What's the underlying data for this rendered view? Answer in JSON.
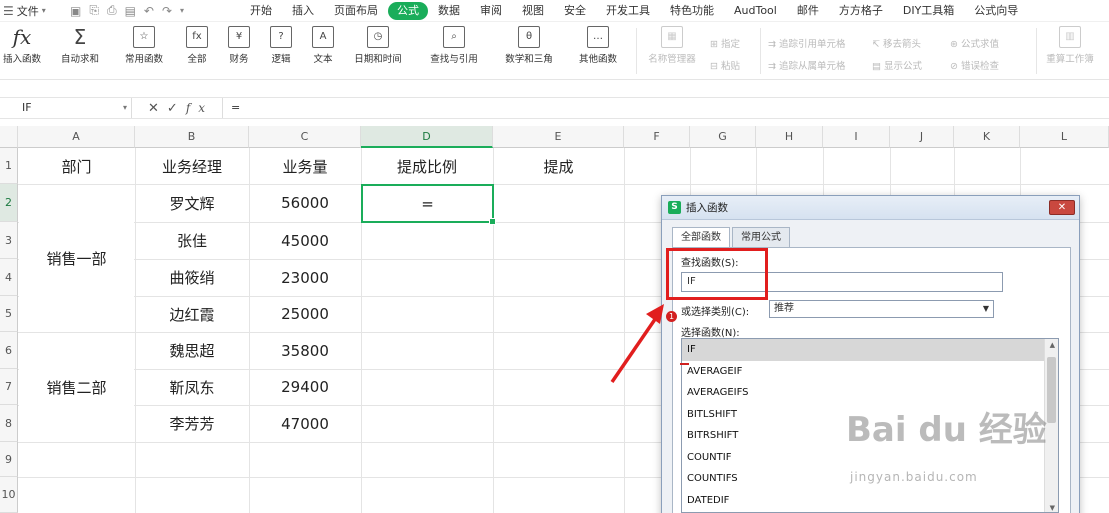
{
  "menubar": {
    "file_label": "文件",
    "tabs": [
      "开始",
      "插入",
      "页面布局",
      "公式",
      "数据",
      "审阅",
      "视图",
      "安全",
      "开发工具",
      "特色功能",
      "AudTool",
      "邮件",
      "方方格子",
      "DIY工具箱",
      "公式向导"
    ],
    "active_tab_index": 3
  },
  "ribbon": {
    "buttons": [
      "插入函数",
      "自动求和",
      "常用函数",
      "全部",
      "财务",
      "逻辑",
      "文本",
      "日期和时间",
      "查找与引用",
      "数学和三角",
      "其他函数"
    ],
    "grayed_big": [
      "名称管理器",
      "重算工作簿"
    ],
    "grayed_small": [
      "指定",
      "粘贴",
      "追踪引用单元格",
      "移去箭头",
      "公式求值",
      "追踪从属单元格",
      "显示公式",
      "错误检查"
    ]
  },
  "formula_bar": {
    "name_box": "IF",
    "content": "="
  },
  "columns": [
    "A",
    "B",
    "C",
    "D",
    "E",
    "F",
    "G",
    "H",
    "I",
    "J",
    "K",
    "L"
  ],
  "rows": [
    "1",
    "2",
    "3",
    "4",
    "5",
    "6",
    "7",
    "8",
    "9",
    "10"
  ],
  "sheet": {
    "headers": [
      "部门",
      "业务经理",
      "业务量",
      "提成比例",
      "提成"
    ],
    "departments": [
      "销售一部",
      "销售二部"
    ],
    "managers": [
      "罗文辉",
      "张佳",
      "曲筱绡",
      "边红霞",
      "魏思超",
      "靳凤东",
      "李芳芳"
    ],
    "volumes": [
      "56000",
      "45000",
      "23000",
      "25000",
      "35800",
      "29400",
      "47000"
    ],
    "active_cell_value": "="
  },
  "dialog": {
    "title": "插入函数",
    "close": "✕",
    "tabs": [
      "全部函数",
      "常用公式"
    ],
    "search_label": "查找函数(S):",
    "search_value": "IF",
    "category_label": "或选择类别(C):",
    "category_value": "推荐",
    "list_label": "选择函数(N):",
    "functions": [
      "IF",
      "AVERAGEIF",
      "AVERAGEIFS",
      "BITLSHIFT",
      "BITRSHIFT",
      "COUNTIF",
      "COUNTIFS",
      "DATEDIF"
    ],
    "annotation_number": "1"
  },
  "watermark": {
    "main": "Bai du 经验",
    "sub": "jingyan.baidu.com"
  },
  "colors": {
    "accent": "#1aad5a",
    "highlight_red": "#e11e1e"
  }
}
